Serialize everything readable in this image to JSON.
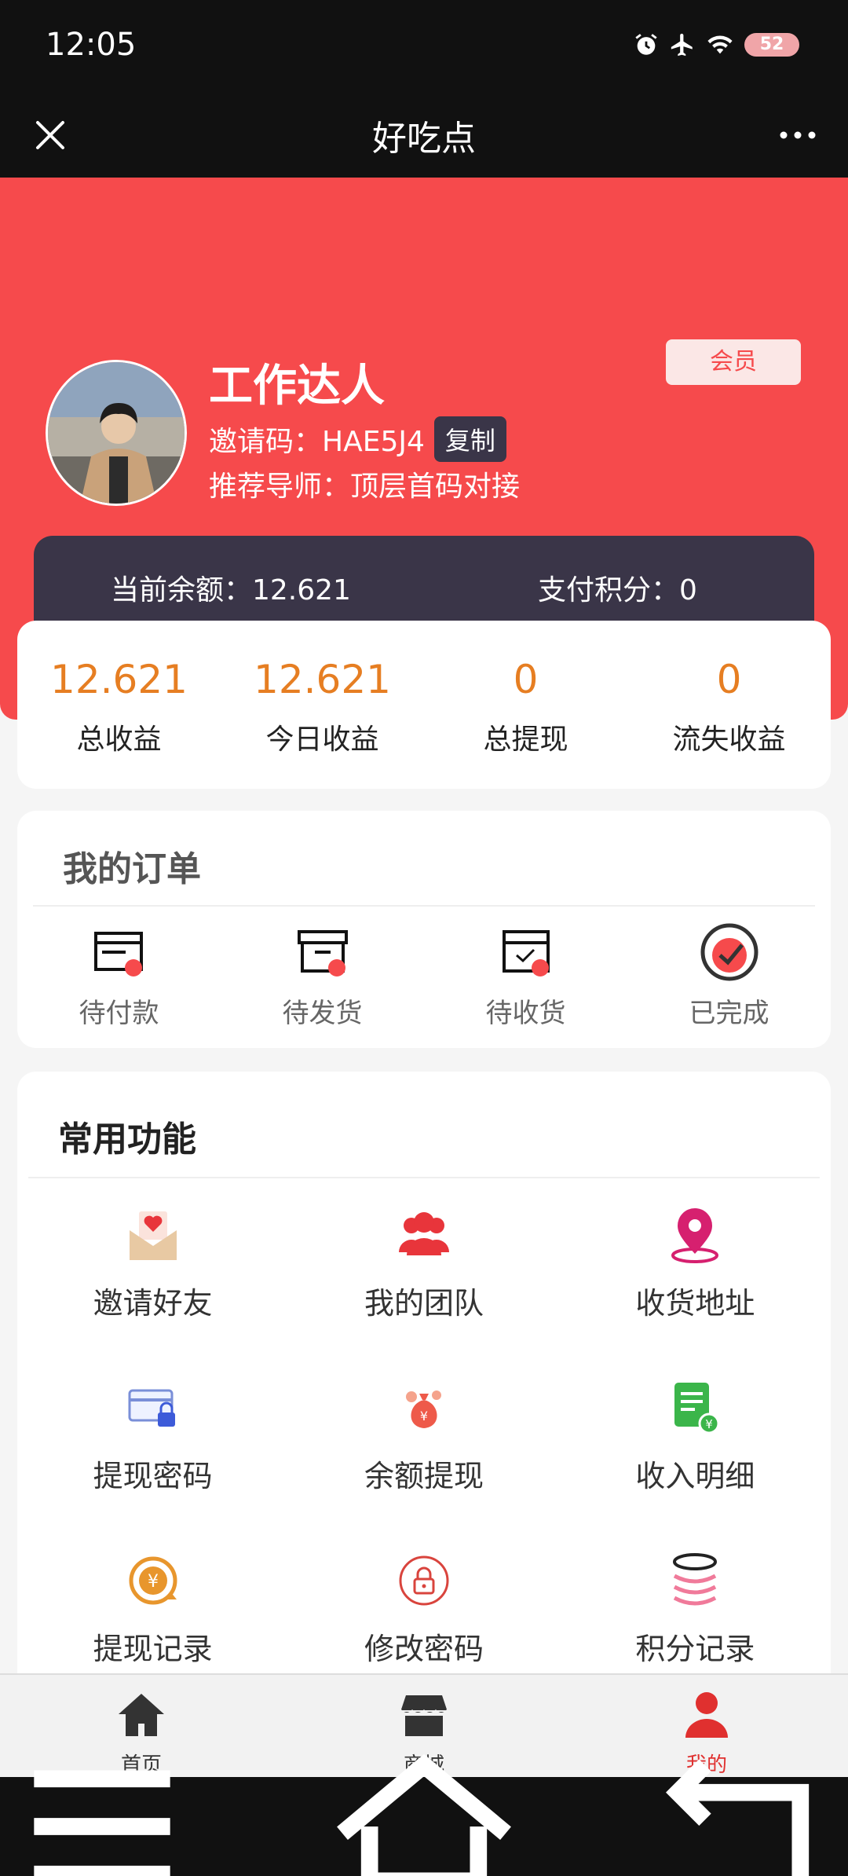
{
  "status_bar": {
    "time": "12:05",
    "battery": "52"
  },
  "titlebar": {
    "title": "好吃点"
  },
  "profile": {
    "name": "工作达人",
    "invite_label": "邀请码：HAE5J4",
    "copy_label": "复制",
    "mentor_label": "推荐导师：顶层首码对接",
    "vip_badge": "会员"
  },
  "balance": {
    "balance_label": "当前余额：12.621",
    "points_label": "支付积分：0"
  },
  "stats": [
    {
      "value": "12.621",
      "label": "总收益"
    },
    {
      "value": "12.621",
      "label": "今日收益"
    },
    {
      "value": "0",
      "label": "总提现"
    },
    {
      "value": "0",
      "label": "流失收益"
    }
  ],
  "orders": {
    "title": "我的订单",
    "items": [
      {
        "label": "待付款",
        "icon": "card-icon"
      },
      {
        "label": "待发货",
        "icon": "box-icon"
      },
      {
        "label": "待收货",
        "icon": "package-check-icon"
      },
      {
        "label": "已完成",
        "icon": "check-circle-icon"
      }
    ]
  },
  "functions": {
    "title": "常用功能",
    "items": [
      {
        "label": "邀请好友",
        "icon": "envelope-heart-icon"
      },
      {
        "label": "我的团队",
        "icon": "team-icon"
      },
      {
        "label": "收货地址",
        "icon": "location-pin-icon"
      },
      {
        "label": "提现密码",
        "icon": "card-lock-icon"
      },
      {
        "label": "余额提现",
        "icon": "money-bag-icon"
      },
      {
        "label": "收入明细",
        "icon": "document-yen-icon"
      },
      {
        "label": "提现记录",
        "icon": "yen-refresh-icon"
      },
      {
        "label": "修改密码",
        "icon": "lock-circle-icon"
      },
      {
        "label": "积分记录",
        "icon": "coin-stack-icon"
      }
    ]
  },
  "tabbar": [
    {
      "label": "首页",
      "icon": "home-icon"
    },
    {
      "label": "商城",
      "icon": "store-icon"
    },
    {
      "label": "我的",
      "icon": "user-icon",
      "active": true
    }
  ],
  "colors": {
    "brand_red": "#f64a4c",
    "dark": "#3a3548",
    "stat_orange": "#e67e22"
  }
}
